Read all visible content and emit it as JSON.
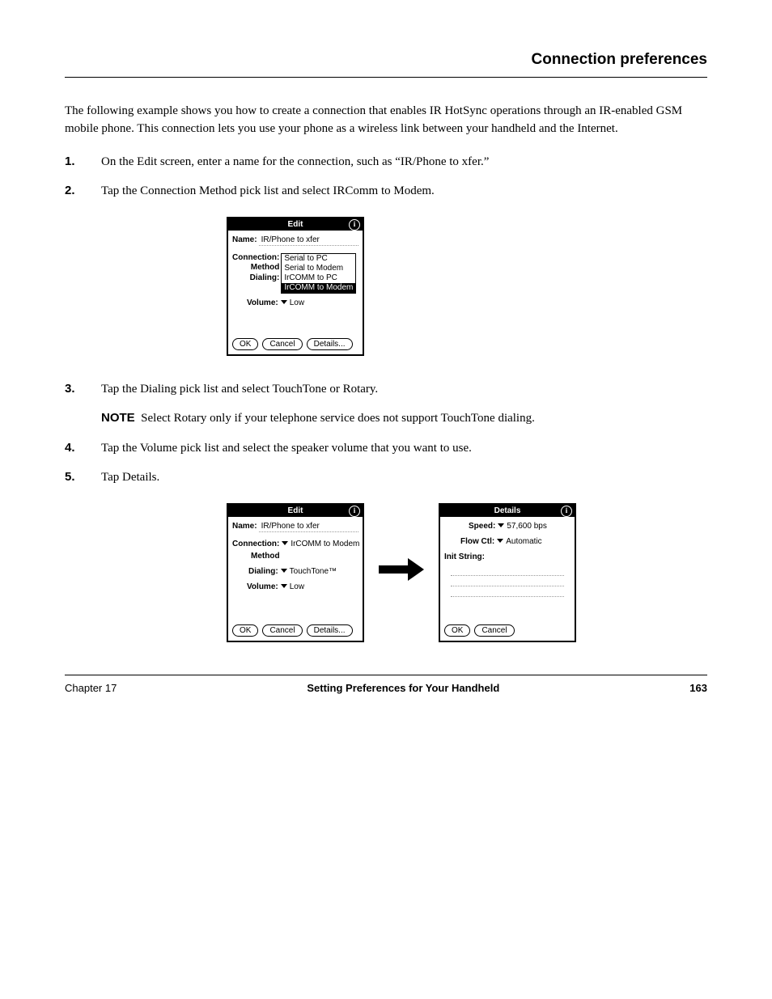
{
  "header": {
    "title": "Connection preferences"
  },
  "intro": "The following example shows you how to create a connection that enables IR HotSync operations through an IR-enabled GSM mobile phone. This connection lets you use your phone as a wireless link between your handheld and the Internet.",
  "steps": {
    "s1": {
      "num": "1.",
      "text": "On the Edit screen, enter a name for the connection, such as “IR/Phone to xfer.”"
    },
    "s2": {
      "num": "2.",
      "text": "Tap the Connection Method pick list and select IRComm to Modem."
    },
    "s3": {
      "num": "3.",
      "text": "Tap the Dialing pick list and select TouchTone or Rotary."
    },
    "note": {
      "label": "NOTE",
      "text": "Select Rotary only if your telephone service does not support TouchTone dialing."
    },
    "s4": {
      "num": "4.",
      "text": "Tap the Volume pick list and select the speaker volume that you want to use."
    },
    "s5": {
      "num": "5.",
      "text": "Tap Details."
    }
  },
  "palm1": {
    "title": "Edit",
    "name_label": "Name:",
    "name_value": "IR/Phone to xfer",
    "conn_label": "Connection:",
    "method_label": "Method",
    "dialing_label": "Dialing:",
    "volume_label": "Volume:",
    "volume_value": "Low",
    "options": [
      "Serial to PC",
      "Serial to Modem",
      "IrCOMM to PC",
      "IrCOMM to Modem"
    ],
    "buttons": {
      "ok": "OK",
      "cancel": "Cancel",
      "details": "Details..."
    }
  },
  "palm2": {
    "title": "Edit",
    "name_label": "Name:",
    "name_value": "IR/Phone to xfer",
    "conn_label": "Connection:",
    "conn_value": "IrCOMM to Modem",
    "method_label": "Method",
    "dialing_label": "Dialing:",
    "dialing_value": "TouchTone™",
    "volume_label": "Volume:",
    "volume_value": "Low",
    "buttons": {
      "ok": "OK",
      "cancel": "Cancel",
      "details": "Details..."
    }
  },
  "palm3": {
    "title": "Details",
    "speed_label": "Speed:",
    "speed_value": "57,600 bps",
    "flow_label": "Flow Ctl:",
    "flow_value": "Automatic",
    "init_label": "Init String:",
    "buttons": {
      "ok": "OK",
      "cancel": "Cancel"
    }
  },
  "footer": {
    "left": "Chapter 17",
    "center": "Setting Preferences for Your Handheld",
    "right": "163"
  }
}
